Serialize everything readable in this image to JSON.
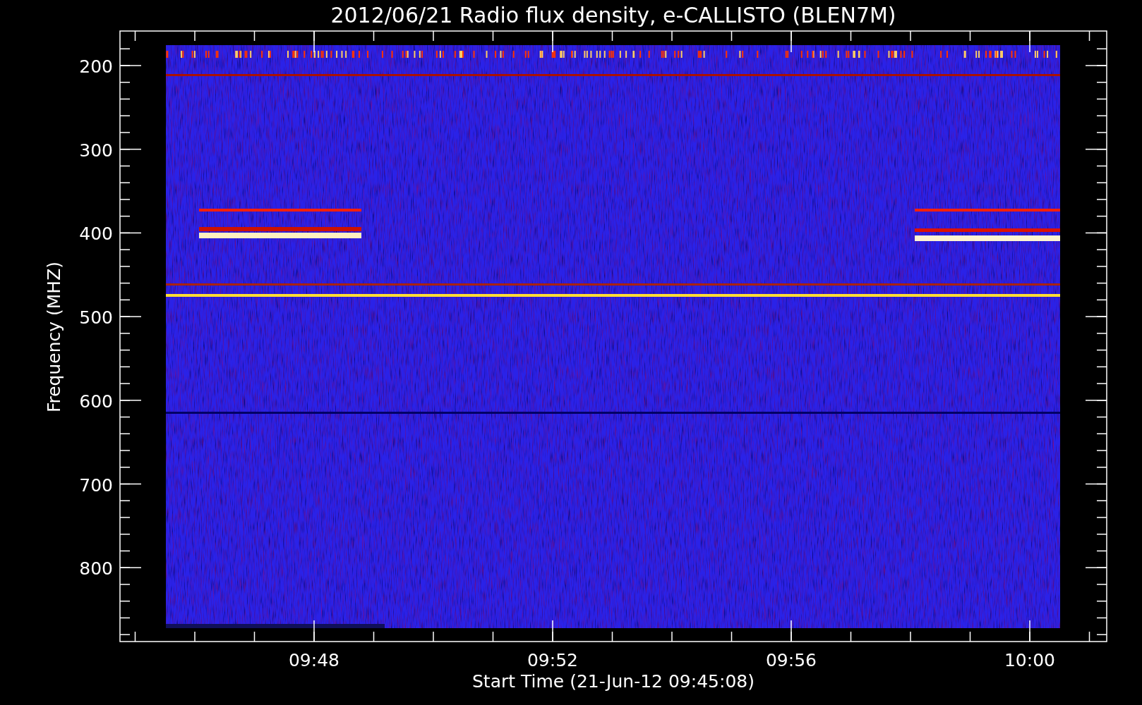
{
  "title": "2012/06/21  Radio flux density, e-CALLISTO (BLEN7M)",
  "y_axis": {
    "label": "Frequency (MHZ)",
    "ticks": [
      "200",
      "300",
      "400",
      "500",
      "600",
      "700",
      "800"
    ]
  },
  "x_axis": {
    "label": "Start Time (21-Jun-12 09:45:08)",
    "ticks": [
      "09:48",
      "09:52",
      "09:56",
      "10:00"
    ]
  }
}
